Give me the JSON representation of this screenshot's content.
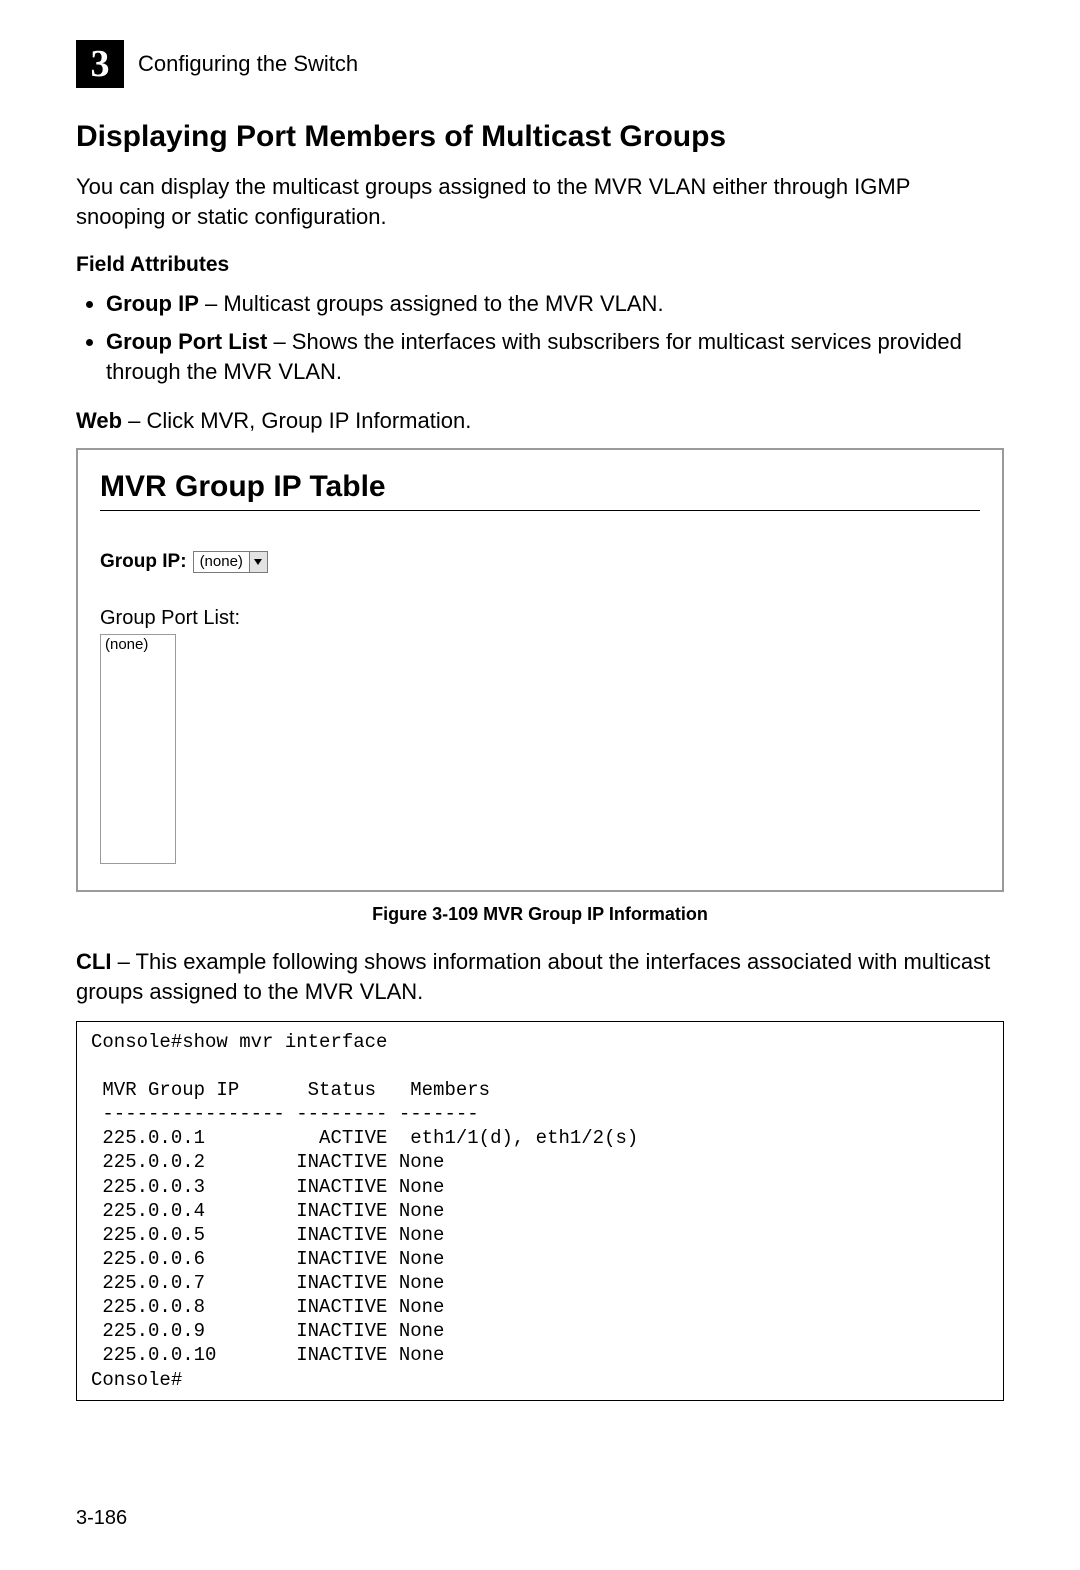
{
  "header": {
    "chapter_number": "3",
    "chapter_title": "Configuring the Switch"
  },
  "section": {
    "heading": "Displaying Port Members of Multicast Groups",
    "intro": "You can display the multicast groups assigned to the MVR VLAN either through IGMP snooping or static configuration.",
    "field_attributes_heading": "Field Attributes",
    "attributes": [
      {
        "name": "Group IP",
        "desc": " – Multicast groups assigned to the MVR VLAN."
      },
      {
        "name": "Group Port List",
        "desc": " – Shows the interfaces with subscribers for multicast services provided through the MVR VLAN."
      }
    ],
    "web_label": "Web",
    "web_text": " – Click MVR, Group IP Information."
  },
  "panel": {
    "title": "MVR Group IP Table",
    "group_ip_label": "Group IP:",
    "group_ip_value": "(none)",
    "port_list_label": "Group Port List:",
    "port_list_value": "(none)"
  },
  "figure_caption": "Figure 3-109  MVR Group IP Information",
  "cli": {
    "label": "CLI",
    "text": " – This example following shows information about the interfaces associated with multicast groups assigned to the MVR VLAN.",
    "output": "Console#show mvr interface\n\n MVR Group IP      Status   Members\n ---------------- -------- -------\n 225.0.0.1          ACTIVE  eth1/1(d), eth1/2(s)\n 225.0.0.2        INACTIVE None\n 225.0.0.3        INACTIVE None\n 225.0.0.4        INACTIVE None\n 225.0.0.5        INACTIVE None\n 225.0.0.6        INACTIVE None\n 225.0.0.7        INACTIVE None\n 225.0.0.8        INACTIVE None\n 225.0.0.9        INACTIVE None\n 225.0.0.10       INACTIVE None\nConsole#"
  },
  "page_number": "3-186"
}
